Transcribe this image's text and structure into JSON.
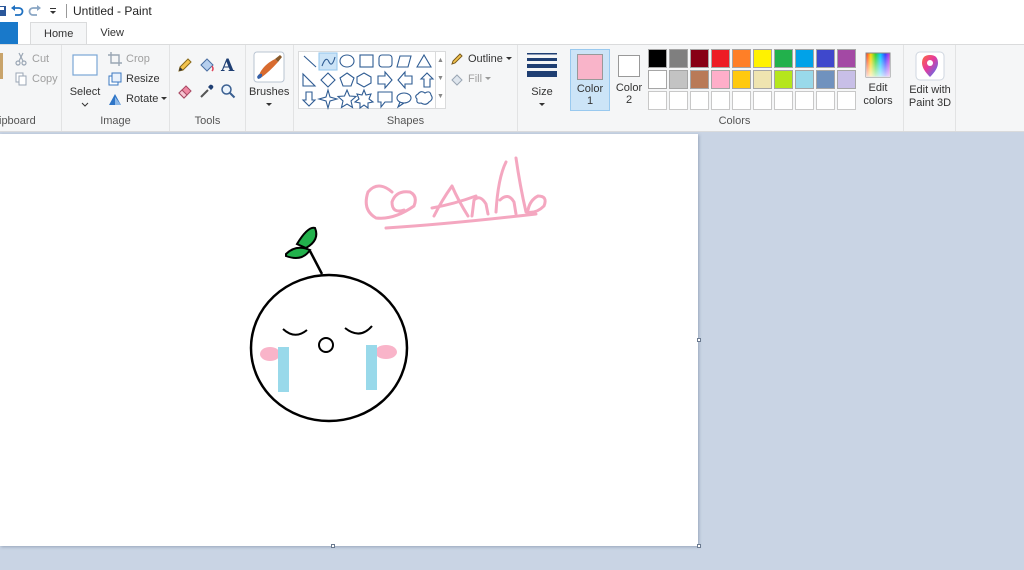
{
  "window": {
    "title": "Untitled - Paint"
  },
  "tabs": [
    {
      "label": "Home",
      "active": true
    },
    {
      "label": "View",
      "active": false
    }
  ],
  "ribbon": {
    "clipboard": {
      "label": "ipboard",
      "cut": "Cut",
      "copy": "Copy"
    },
    "image": {
      "label": "Image",
      "select": "Select",
      "crop": "Crop",
      "resize": "Resize",
      "rotate": "Rotate"
    },
    "tools": {
      "label": "Tools"
    },
    "brushes": {
      "label": "Brushes"
    },
    "shapes": {
      "label": "Shapes",
      "outline": "Outline",
      "fill": "Fill"
    },
    "size": {
      "label": "Size"
    },
    "colors": {
      "label": "Colors",
      "color1_line1": "Color",
      "color1_line2": "1",
      "color2_line1": "Color",
      "color2_line2": "2",
      "color1": "#f9b4c9",
      "color2": "#ffffff",
      "edit_line1": "Edit",
      "edit_line2": "colors",
      "palette_row1": [
        "#000000",
        "#7f7f7f",
        "#880015",
        "#ed1c24",
        "#ff7f27",
        "#fff200",
        "#22b14c",
        "#00a2e8",
        "#3f48cc",
        "#a349a4"
      ],
      "palette_row2": [
        "#ffffff",
        "#c3c3c3",
        "#b97a57",
        "#ffaec9",
        "#ffc90e",
        "#efe4b0",
        "#b5e61d",
        "#99d9ea",
        "#7092be",
        "#c8bfe7"
      ],
      "palette_row3": [
        "#ffffff",
        "#ffffff",
        "#ffffff",
        "#ffffff",
        "#ffffff",
        "#ffffff",
        "#ffffff",
        "#ffffff",
        "#ffffff",
        "#ffffff"
      ]
    },
    "paint3d": {
      "line1": "Edit with",
      "line2": "Paint 3D"
    }
  },
  "drawing": {
    "pink": "#f4a7c0",
    "leaf": "#22b14c",
    "tear": "#99d9ea",
    "blush": "#f9b4c9"
  }
}
